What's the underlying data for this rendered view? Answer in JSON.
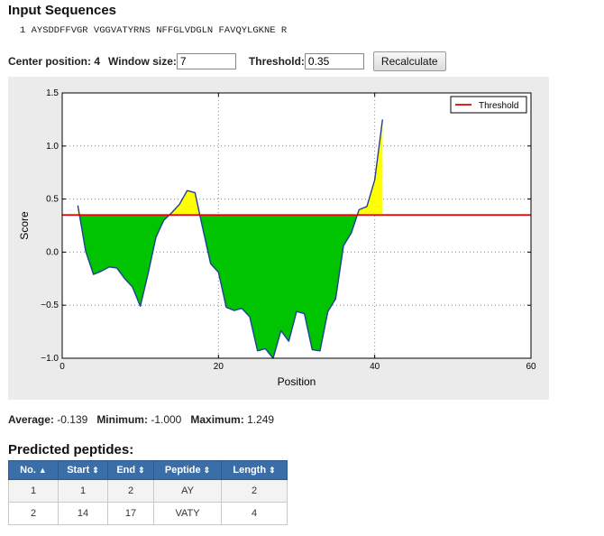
{
  "input": {
    "title": "Input Sequences",
    "sequence_line": "1 AYSDDFFVGR VGGVATYRNS NFFGLVDGLN FAVQYLGKNE R"
  },
  "controls": {
    "center_label": "Center position: 4",
    "window_label": "Window size:",
    "window_value": "7",
    "threshold_label": "Threshold:",
    "threshold_value": "0.35",
    "recalc_label": "Recalculate"
  },
  "chart_data": {
    "type": "line",
    "xlabel": "Position",
    "ylabel": "Score",
    "xlim": [
      0,
      60
    ],
    "ylim": [
      -1.0,
      1.5
    ],
    "xticks": [
      0,
      20,
      40,
      60
    ],
    "yticks": [
      1.5,
      1.0,
      0.5,
      0.0,
      -0.5,
      -1.0
    ],
    "ytick_labels": [
      "1.5",
      "1.0",
      "0.5",
      "0.0",
      "−0.5",
      "−1.0"
    ],
    "grid": true,
    "legend": {
      "position": "top-right",
      "entries": [
        "Threshold"
      ]
    },
    "threshold": 0.35,
    "colors": {
      "line": "#1f3f99",
      "threshold": "#e00000",
      "above": "#ffff00",
      "below": "#00c400"
    },
    "x": [
      2,
      3,
      4,
      5,
      6,
      7,
      8,
      9,
      10,
      11,
      12,
      13,
      14,
      15,
      16,
      17,
      18,
      19,
      20,
      21,
      22,
      23,
      24,
      25,
      26,
      27,
      28,
      29,
      30,
      31,
      32,
      33,
      34,
      35,
      36,
      37,
      38,
      39,
      40,
      41
    ],
    "y": [
      0.44,
      0.01,
      -0.21,
      -0.18,
      -0.14,
      -0.15,
      -0.25,
      -0.33,
      -0.51,
      -0.2,
      0.14,
      0.3,
      0.37,
      0.45,
      0.58,
      0.56,
      0.22,
      -0.11,
      -0.19,
      -0.52,
      -0.55,
      -0.53,
      -0.61,
      -0.93,
      -0.91,
      -1.0,
      -0.74,
      -0.84,
      -0.56,
      -0.58,
      -0.92,
      -0.93,
      -0.56,
      -0.44,
      0.06,
      0.18,
      0.4,
      0.43,
      0.68,
      1.25
    ]
  },
  "stats": {
    "average_label": "Average:",
    "average_value": "-0.139",
    "minimum_label": "Minimum:",
    "minimum_value": "-1.000",
    "maximum_label": "Maximum:",
    "maximum_value": "1.249"
  },
  "peptides": {
    "title": "Predicted peptides:",
    "headers": [
      "No.",
      "Start",
      "End",
      "Peptide",
      "Length"
    ],
    "rows": [
      [
        "1",
        "1",
        "2",
        "AY",
        "2"
      ],
      [
        "2",
        "14",
        "17",
        "VATY",
        "4"
      ]
    ]
  }
}
